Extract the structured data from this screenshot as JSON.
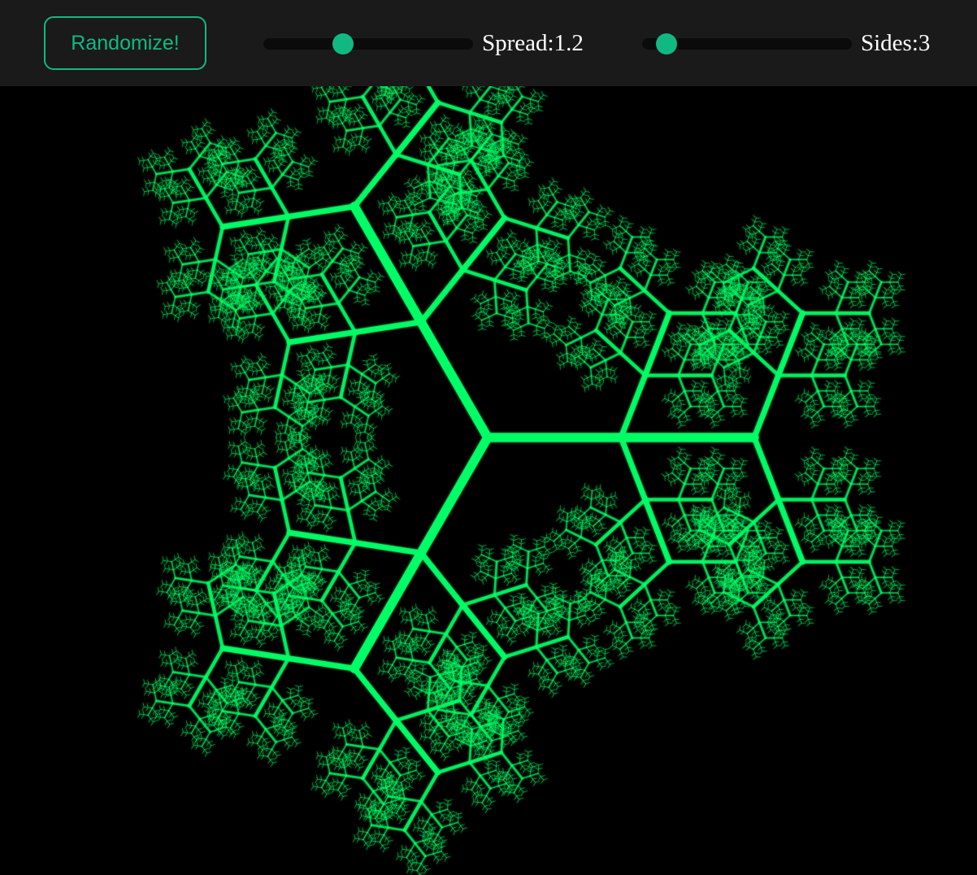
{
  "toolbar": {
    "randomize_label": "Randomize!",
    "spread": {
      "label": "Spread:",
      "value": "1.2",
      "fraction": 0.38
    },
    "sides": {
      "label": "Sides:",
      "value": "3",
      "fraction": 0.115
    }
  },
  "fractal": {
    "sides": 3,
    "spread": 1.2,
    "depth": 6,
    "color": "#00ff66",
    "background": "#000000"
  },
  "colors": {
    "accent": "#10b981",
    "toolbar_bg": "#1a1a1a",
    "canvas_bg": "#000000"
  }
}
